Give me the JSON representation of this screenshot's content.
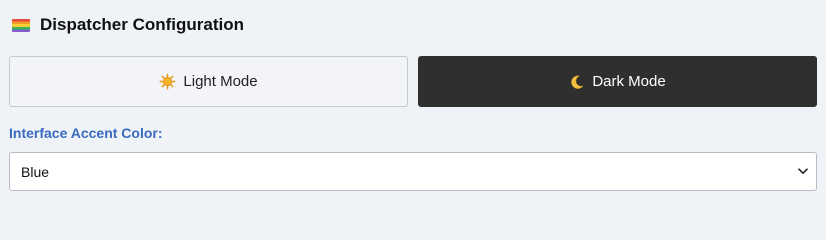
{
  "header": {
    "icon": "rainbow-flag-icon",
    "title": "Dispatcher Configuration"
  },
  "modes": {
    "light": {
      "label": "Light Mode",
      "icon": "sun-icon"
    },
    "dark": {
      "label": "Dark Mode",
      "icon": "crescent-moon-icon",
      "selected": true
    }
  },
  "accent": {
    "label": "Interface Accent Color:",
    "selected": "Blue",
    "icon": "chevron-down-icon"
  },
  "colors": {
    "background": "#eff2f7",
    "dark_button": "#2f2f2f",
    "label_blue": "#3a6bbf"
  }
}
